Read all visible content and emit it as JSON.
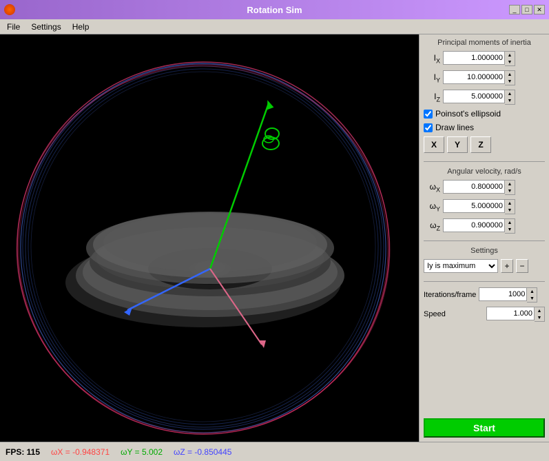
{
  "window": {
    "title": "Rotation Sim",
    "icon": "app-icon"
  },
  "menu": {
    "items": [
      "File",
      "Settings",
      "Help"
    ]
  },
  "panel": {
    "principal_moments_label": "Principal moments of inertia",
    "Ix_label": "I",
    "Ix_sub": "X",
    "Ix_value": "1.000000",
    "Iy_label": "I",
    "Iy_sub": "Y",
    "Iy_value": "10.000000",
    "Iz_label": "I",
    "Iz_sub": "Z",
    "Iz_value": "5.000000",
    "poinsot_label": "Poinsot's ellipsoid",
    "drawlines_label": "Draw lines",
    "btn_x": "X",
    "btn_y": "Y",
    "btn_z": "Z",
    "angular_velocity_label": "Angular velocity, rad/s",
    "wx_label": "ω",
    "wx_sub": "X",
    "wx_value": "0.800000",
    "wy_label": "ω",
    "wy_sub": "Y",
    "wy_value": "5.000000",
    "wz_label": "ω",
    "wz_sub": "Z",
    "wz_value": "0.900000",
    "settings_label": "Settings",
    "dropdown_value": "Iy is maximum",
    "iterations_label": "Iterations/frame",
    "iterations_value": "1000",
    "speed_label": "Speed",
    "speed_value": "1.000",
    "start_btn": "Start"
  },
  "status": {
    "fps_label": "FPS: 115",
    "wx_label": "ωX = -0.948371",
    "wy_label": "ωY = 5.002",
    "wz_label": "ωZ = -0.850445"
  }
}
